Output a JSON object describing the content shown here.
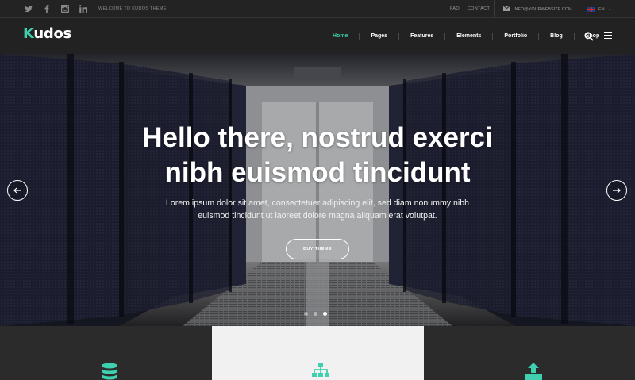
{
  "topbar": {
    "social": [
      "twitter-icon",
      "facebook-icon",
      "instagram-icon",
      "linkedin-icon"
    ],
    "welcome": "WELCOME TO KUDOS THEME.",
    "links": [
      "FAQ",
      "CONTACT"
    ],
    "email": "INFO@YOURWEBSITE.COM",
    "language": "EN"
  },
  "nav": {
    "logo_first": "K",
    "logo_rest": "udos",
    "items": [
      {
        "label": "Home",
        "active": true
      },
      {
        "label": "Pages"
      },
      {
        "label": "Features"
      },
      {
        "label": "Elements"
      },
      {
        "label": "Portfolio"
      },
      {
        "label": "Blog"
      },
      {
        "label": "Shop"
      }
    ]
  },
  "hero": {
    "title_line1": "Hello there, nostrud exerci",
    "title_line2": "nibh euismod tincidunt",
    "subtitle_line1": "Lorem ipsum dolor sit amet, consectetuer adipiscing elit, sed diam nonummy nibh",
    "subtitle_line2": "euismod tincidunt ut laoreet dolore magna aliquam erat volutpat.",
    "button": "BUY THEME",
    "slide_count": 3,
    "active_slide": 3
  },
  "features": [
    "database-icon",
    "sitemap-icon",
    "upload-icon"
  ],
  "colors": {
    "accent": "#3fd0b0",
    "dark": "#222222"
  }
}
